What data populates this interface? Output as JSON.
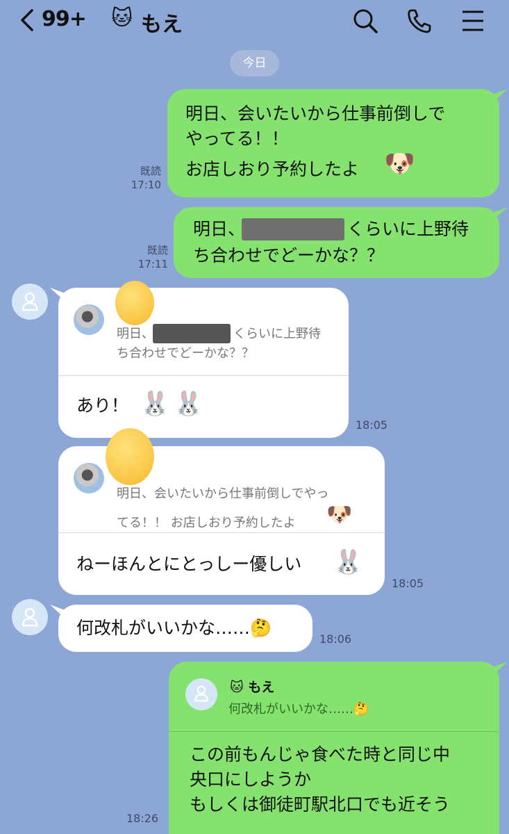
{
  "header": {
    "back_icon": "chevron-left-icon",
    "unread_count": "99+",
    "contact_emoji": "🐱",
    "contact_name": "もえ",
    "icons": [
      "search-icon",
      "phone-icon",
      "menu-icon"
    ]
  },
  "date_label": "今日",
  "messages": [
    {
      "side": "right",
      "lines": [
        "明日、会いたいから仕事前倒しで",
        "やってる！！",
        "お店しおり予約したよ"
      ],
      "read": "既読",
      "time": "17:10"
    },
    {
      "side": "right",
      "lines_before": "明日、",
      "lines_after": "くらいに上野待",
      "line2": "ち合わせでどーかな？？",
      "read": "既読",
      "time": "17:11"
    },
    {
      "side": "left",
      "quote_line1_before": "明日、",
      "quote_line1_after": "くらいに上野待",
      "quote_line2": "ち合わせでどーかな？？",
      "text": "あり！",
      "time": "18:05"
    },
    {
      "side": "left",
      "quote_line1": "明日、会いたいから仕事前倒しでやっ",
      "quote_line2": "てる！！ お店しおり予約したよ",
      "text": "ねーほんとにとっしー優しい",
      "time": "18:05"
    },
    {
      "side": "left",
      "text": "何改札がいいかな……🤔",
      "time": "18:06"
    },
    {
      "side": "right",
      "reply_name": "🐱 もえ",
      "reply_text": "何改札がいいかな……🤔",
      "lines": [
        "この前もんじゃ食べた時と同じ中",
        "央口にしようか",
        "もしくは御徒町駅北口でも近そう"
      ],
      "time": "18:26"
    }
  ],
  "colors": {
    "background": "#8ca6d6",
    "green_bubble": "#85e26f",
    "white_bubble": "#ffffff"
  }
}
